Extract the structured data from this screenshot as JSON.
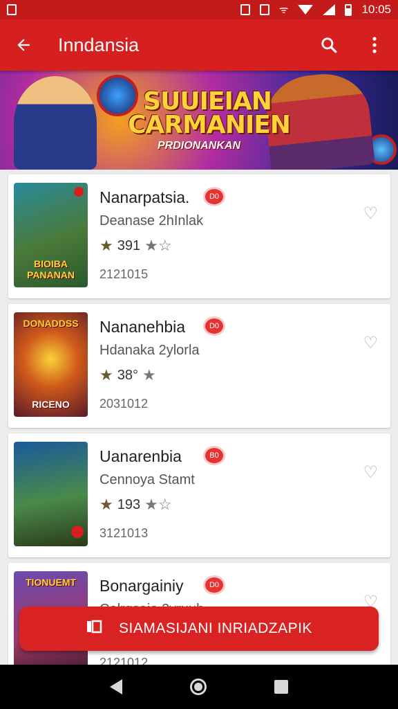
{
  "status_bar": {
    "left_icon": "sim-icon",
    "time": "10:05"
  },
  "app_bar": {
    "title": "Inndansia",
    "back_icon": "back-arrow-icon",
    "search_icon": "search-icon",
    "menu_icon": "more-vert-icon"
  },
  "banner": {
    "title": "SUUIEIAN CARMANIEN",
    "subtitle": "PRDIONANKAN"
  },
  "apps": [
    {
      "name": "Nanarpatsia.",
      "badge": "D0",
      "developer": "Deanase 2hInlak",
      "rating": "391",
      "date": "2121015",
      "thumb_label": "BIOIBA PANANAN",
      "fav_icon": "heart-outline-icon"
    },
    {
      "name": "Nananehbia",
      "badge": "D0",
      "developer": "Hdanaka 2ylorla",
      "rating": "38°",
      "date": "2031012",
      "thumb_label": "RICENO",
      "top_label": "DONADDSS",
      "fav_icon": "heart-outline-icon"
    },
    {
      "name": "Uanarenbia",
      "badge": "B0",
      "developer": "Cennoya Stamt",
      "rating": "193",
      "date": "3121013",
      "thumb_label": "",
      "fav_icon": "heart-outline-icon"
    },
    {
      "name": "Bonargainiy",
      "badge": "D0",
      "developer": "Calrgsaie 2yruub",
      "rating": "",
      "date": "2121012",
      "thumb_label": "TIONUEMT",
      "fav_icon": "heart-outline-icon"
    }
  ],
  "fab": {
    "label": "SIAMASIJANI INRIADZAPIK",
    "icon": "book-icon"
  },
  "colors": {
    "primary": "#d61f1f",
    "status_bar": "#c41a1a",
    "accent": "#e53232"
  }
}
